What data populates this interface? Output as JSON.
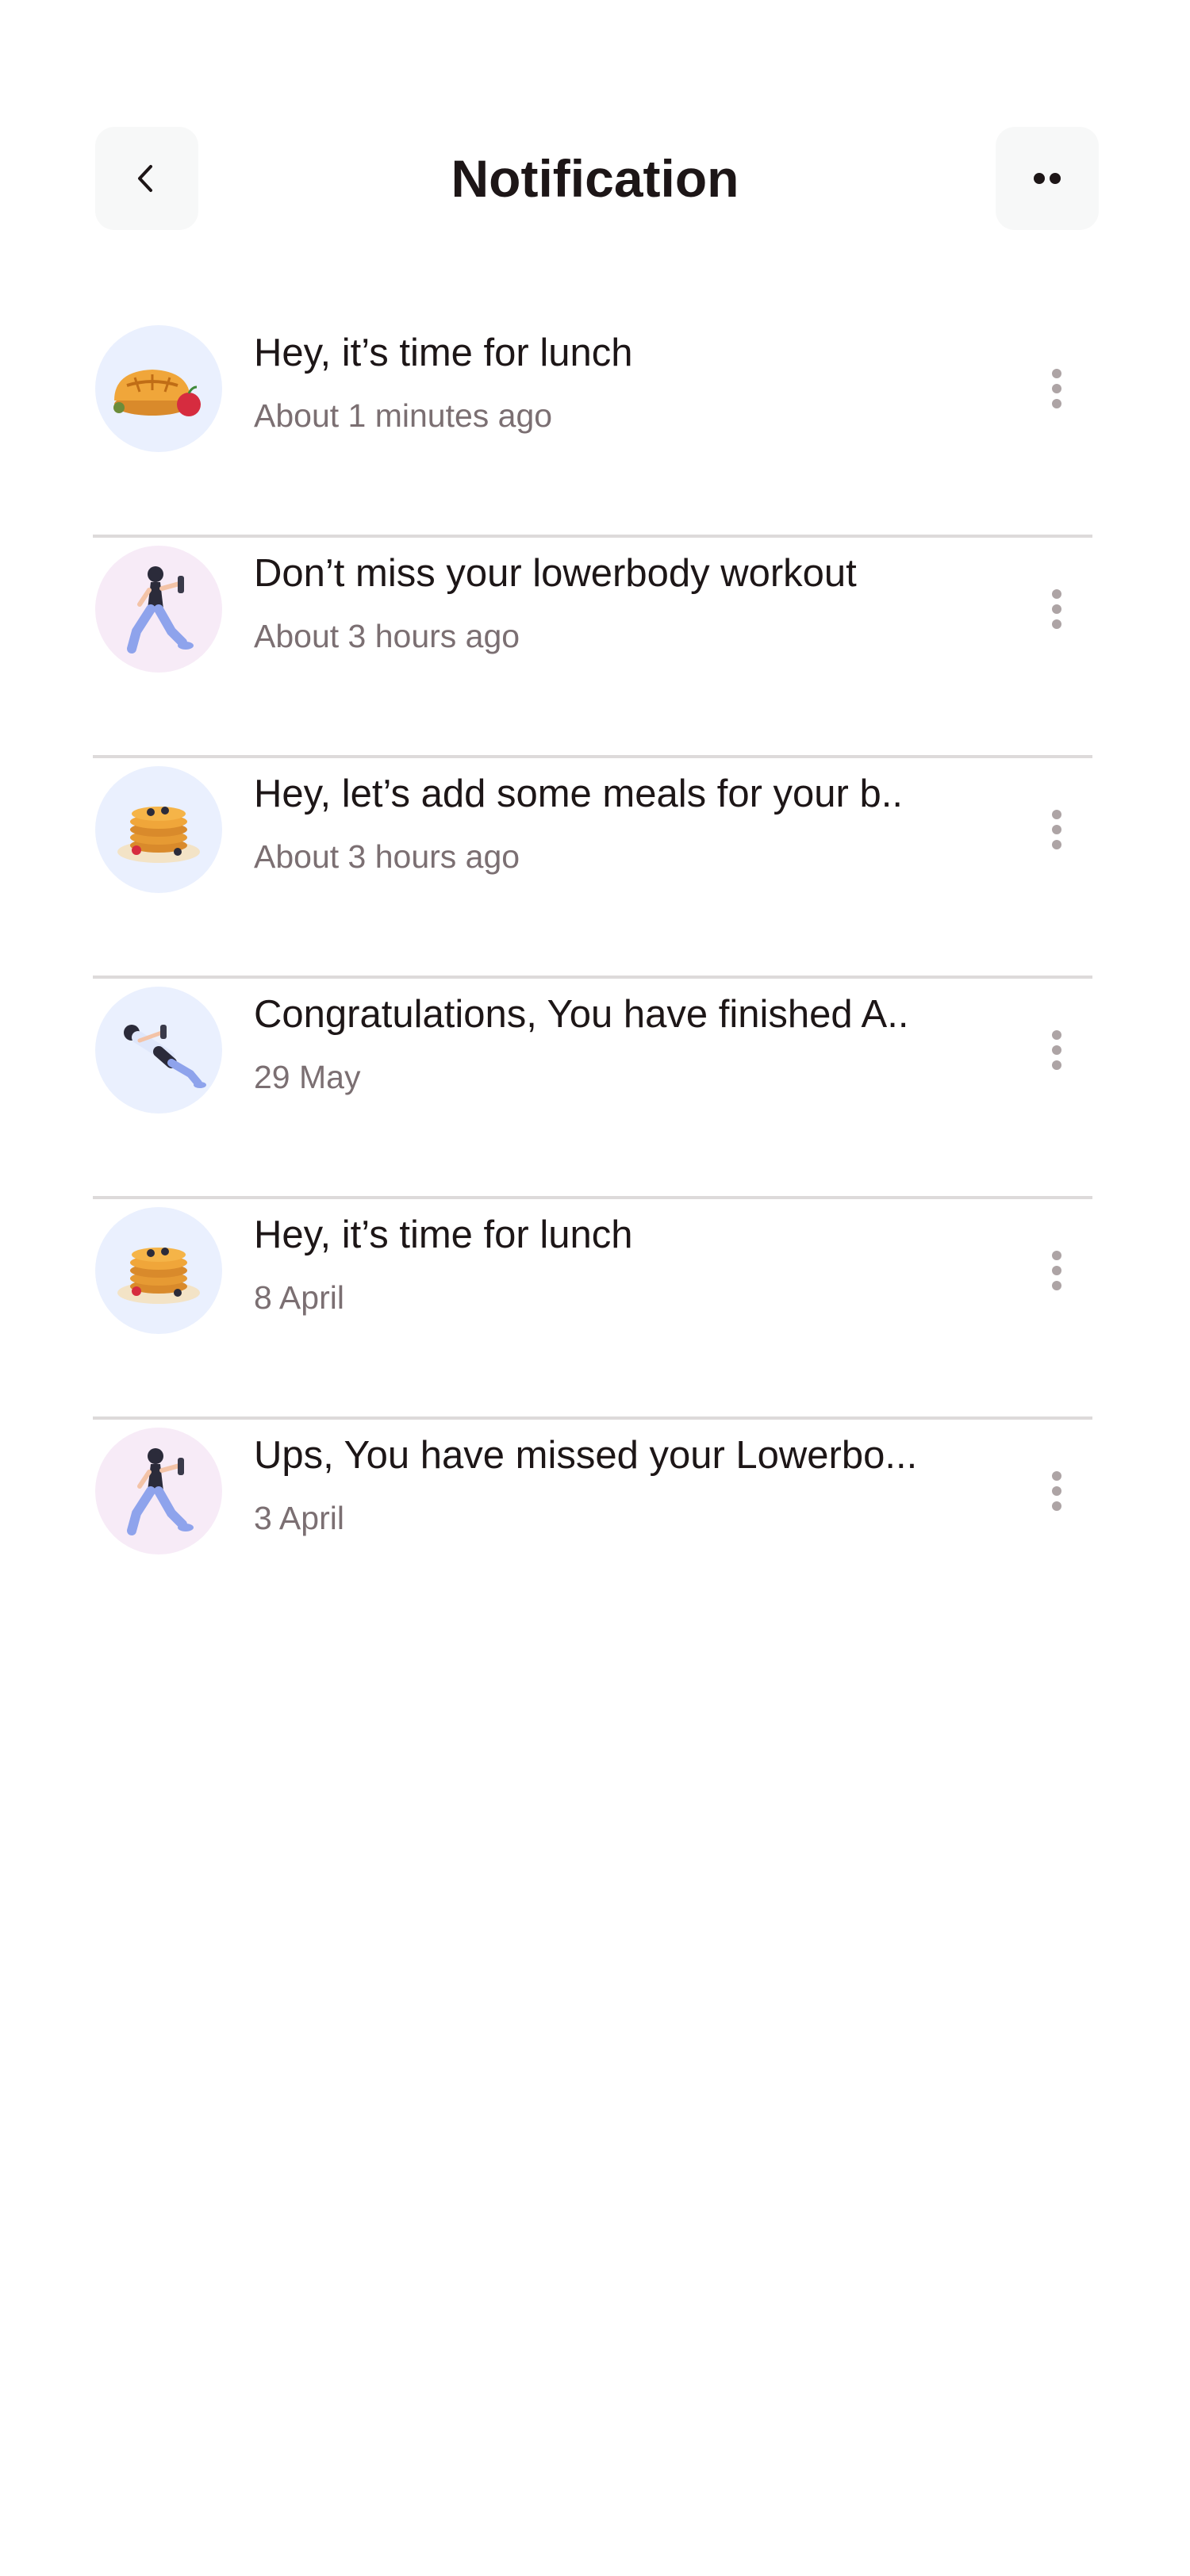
{
  "header": {
    "title": "Notification",
    "back_icon": "chevron-left-icon",
    "more_icon": "more-horizontal-icon"
  },
  "notifications": [
    {
      "title": "Hey, it’s time for lunch",
      "time": "About 1 minutes ago",
      "icon": "pie-meal-icon",
      "tint": "#eaf0fe"
    },
    {
      "title": "Don’t miss your lowerbody workout",
      "time": "About 3 hours ago",
      "icon": "lunge-workout-icon",
      "tint": "#f7ebf7"
    },
    {
      "title": "Hey, let’s add some meals for your b..",
      "time": "About 3 hours ago",
      "icon": "pancake-meal-icon",
      "tint": "#eaf0fe"
    },
    {
      "title": "Congratulations, You have finished A..",
      "time": "29 May",
      "icon": "abs-workout-icon",
      "tint": "#eaf0fe"
    },
    {
      "title": "Hey, it’s time for lunch",
      "time": "8 April",
      "icon": "pancake-meal-icon",
      "tint": "#eaf0fe"
    },
    {
      "title": "Ups, You have missed your Lowerbo...",
      "time": "3 April",
      "icon": "lunge-workout-icon",
      "tint": "#f7ebf7"
    }
  ],
  "colors": {
    "title_text": "#1d1617",
    "secondary_text": "#7b6f72",
    "divider": "#dddada",
    "button_bg": "#f7f8f8",
    "dot": "#ada4a5"
  }
}
